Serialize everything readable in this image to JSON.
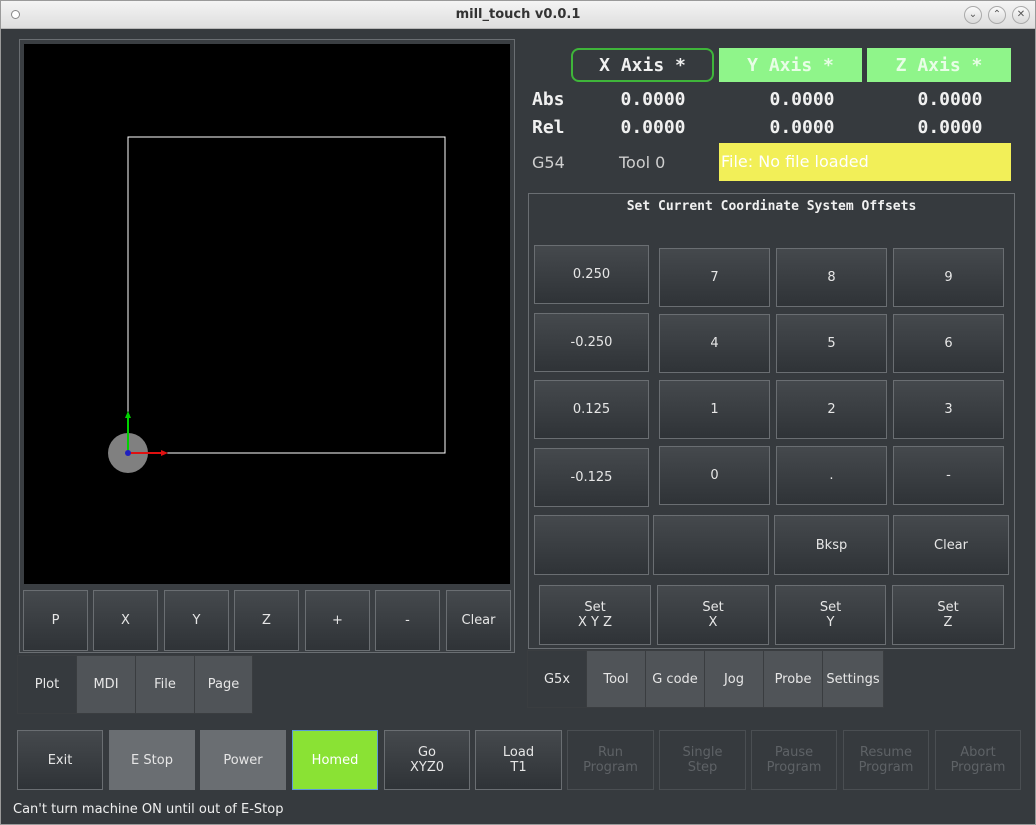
{
  "window": {
    "title": "mill_touch v0.0.1"
  },
  "plot": {
    "buttons": [
      "P",
      "X",
      "Y",
      "Z",
      "+",
      "-",
      "Clear"
    ]
  },
  "left_tabs": [
    "Plot",
    "MDI",
    "File",
    "Page"
  ],
  "axes": [
    {
      "label": "X Axis *",
      "bg": "#363a3e",
      "fg": "#f0f0f0",
      "border": "#3fb53a"
    },
    {
      "label": "Y Axis *",
      "bg": "#8ff58a",
      "fg": "#e8fde6",
      "border": "#8ff58a"
    },
    {
      "label": "Z Axis *",
      "bg": "#8ff58a",
      "fg": "#e8fde6",
      "border": "#8ff58a"
    }
  ],
  "dro": {
    "abs_label": "Abs",
    "rel_label": "Rel",
    "abs": [
      "0.0000",
      "0.0000",
      "0.0000"
    ],
    "rel": [
      "0.0000",
      "0.0000",
      "0.0000"
    ]
  },
  "info": {
    "coord_system": "G54",
    "tool": "Tool 0",
    "file": "File: No file loaded"
  },
  "offsets_panel": {
    "title": "Set Current Coordinate System Offsets",
    "increments": [
      "0.250",
      "-0.250",
      "0.125",
      "-0.125"
    ],
    "keypad": [
      "7",
      "8",
      "9",
      "4",
      "5",
      "6",
      "1",
      "2",
      "3",
      "0",
      ".",
      "-"
    ],
    "bksp": "Bksp",
    "clear": "Clear",
    "set_buttons": [
      "Set\nX Y Z",
      "Set\nX",
      "Set\nY",
      "Set\nZ"
    ]
  },
  "right_tabs": [
    "G5x",
    "Tool",
    "G code",
    "Jog",
    "Probe",
    "Settings"
  ],
  "bottom_buttons": [
    {
      "label": "Exit",
      "style": "normal"
    },
    {
      "label": "E Stop",
      "style": "grey"
    },
    {
      "label": "Power",
      "style": "grey"
    },
    {
      "label": "Homed",
      "style": "green"
    },
    {
      "label": "Go\nXYZ0",
      "style": "normal"
    },
    {
      "label": "Load\nT1",
      "style": "normal"
    },
    {
      "label": "Run\nProgram",
      "style": "disabled"
    },
    {
      "label": "Single\nStep",
      "style": "disabled"
    },
    {
      "label": "Pause\nProgram",
      "style": "disabled"
    },
    {
      "label": "Resume\nProgram",
      "style": "disabled"
    },
    {
      "label": "Abort\nProgram",
      "style": "disabled"
    }
  ],
  "status": "Can't turn machine ON until out of E-Stop",
  "colors": {
    "accent_green": "#8ff58a",
    "homed_green": "#8ae234",
    "file_yellow": "#f2ef58"
  }
}
